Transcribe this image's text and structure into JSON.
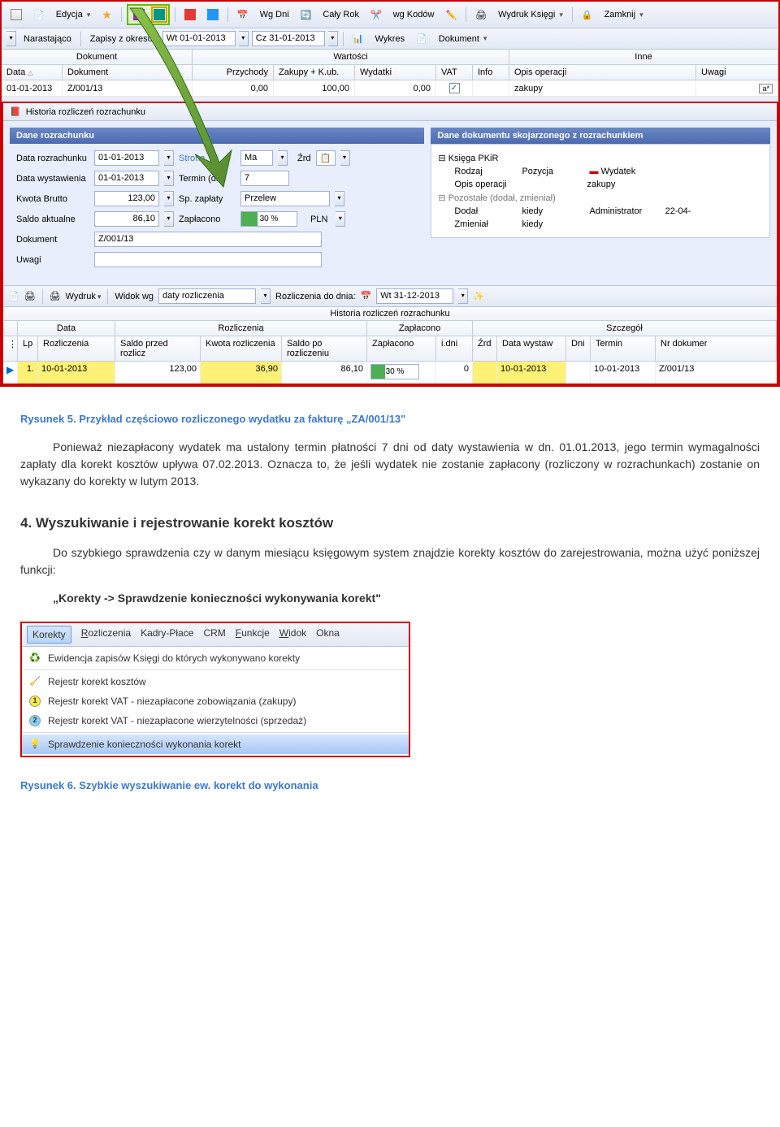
{
  "toolbar": {
    "edycja": "Edycja",
    "wg_dni": "Wg Dni",
    "caly_rok": "Cały Rok",
    "wg_kodow": "wg Kodów",
    "wydruk_ksiegi": "Wydruk Księgi",
    "zamknij": "Zamknij"
  },
  "toolbar2": {
    "narastajaco": "Narastająco",
    "zapisy_z_okresu": "Zapisy z okresu:",
    "date_from": "Wt 01-01-2013",
    "date_to": "Cz 31-01-2013",
    "wykres": "Wykres",
    "dokument": "Dokument"
  },
  "grid": {
    "groups": {
      "dokument": "Dokument",
      "wartosci": "Wartości",
      "inne": "Inne"
    },
    "cols": {
      "data": "Data",
      "dokument": "Dokument",
      "przychody": "Przychody",
      "zakupy": "Zakupy + K.ub.",
      "wydatki": "Wydatki",
      "vat": "VAT",
      "info": "Info",
      "opis": "Opis operacji",
      "uwagi": "Uwagi"
    },
    "row": {
      "data": "01-01-2013",
      "dokument": "Z/001/13",
      "przychody": "0,00",
      "zakupy": "100,00",
      "wydatki": "0,00",
      "vat_checked": "✓",
      "opis": "zakupy"
    }
  },
  "panel": {
    "title": "Historia rozliczeń rozrachunku",
    "left_hdr": "Dane rozrachunku",
    "right_hdr": "Dane dokumentu skojarzonego z rozrachunkiem",
    "left": {
      "data_rozr_lbl": "Data rozrachunku",
      "data_rozr": "01-01-2013",
      "strona_lbl": "Strona",
      "strona": "Ma",
      "zrd_lbl": "Źrd",
      "data_wyst_lbl": "Data wystawienia",
      "data_wyst": "01-01-2013",
      "termin_lbl": "Termin (dni)",
      "termin": "7",
      "kwota_lbl": "Kwota Brutto",
      "kwota": "123,00",
      "sp_zaplaty_lbl": "Sp. zapłaty",
      "sp_zaplaty": "Przelew",
      "saldo_lbl": "Saldo aktualne",
      "saldo": "86,10",
      "zaplacono_lbl": "Zapłacono",
      "zaplacono_pct": "30 %",
      "pln": "PLN",
      "dokument_lbl": "Dokument",
      "dokument": "Z/001/13",
      "uwagi_lbl": "Uwagi"
    },
    "right": {
      "ksiega": "Księga PKiR",
      "rodzaj_lbl": "Rodzaj",
      "pozycja_lbl": "Pozycja",
      "wydatek": "Wydatek",
      "opis_lbl": "Opis operacji",
      "opis": "zakupy",
      "pozostale": "Pozostałe (dodał, zmieniał)",
      "dodal_lbl": "Dodał",
      "kiedy_lbl": "kiedy",
      "admin": "Administrator",
      "data": "22-04-",
      "zmienial_lbl": "Zmieniał",
      "kiedy2_lbl": "kiedy"
    }
  },
  "bottom_tb": {
    "wydruk": "Wydruk",
    "widok_wg": "Widok wg",
    "daty_rozl": "daty rozliczenia",
    "rozl_do_dnia": "Rozliczenia do dnia:",
    "date": "Wt 31-12-2013"
  },
  "hist": {
    "title": "Historia rozliczeń rozrachunku",
    "groups": {
      "data": "Data",
      "rozl": "Rozliczenia",
      "zapl": "Zapłacono",
      "szcz": "Szczegół"
    },
    "cols": {
      "lp": "Lp",
      "rozl": "Rozliczenia",
      "saldo_przed": "Saldo przed rozlicz",
      "kwota": "Kwota rozliczenia",
      "saldo_po": "Saldo po rozliczeniu",
      "zapl": "Zapłacono",
      "idni": "i.dni",
      "zrd": "Źrd",
      "data_wyst": "Data wystaw",
      "dni": "Dni",
      "termin": "Termin",
      "nr_dok": "Nr dokumer"
    },
    "row": {
      "lp": "1.",
      "rozl": "10-01-2013",
      "saldo_przed": "123,00",
      "kwota": "36,90",
      "saldo_po": "86,10",
      "zapl": "30 %",
      "idni": "0",
      "data_wyst": "10-01-2013",
      "termin": "10-01-2013",
      "nr_dok": "Z/001/13"
    }
  },
  "doc": {
    "fig5": "Rysunek 5. Przykład częściowo rozliczonego wydatku za fakturę „ZA/001/13\"",
    "para1": "Ponieważ niezapłacony wydatek ma ustalony termin płatności 7 dni od daty wystawienia w dn. 01.01.2013, jego termin wymagalności zapłaty dla korekt kosztów upływa 07.02.2013. Oznacza to, że jeśli wydatek nie zostanie zapłacony (rozliczony w rozrachunkach) zostanie on wykazany do korekty w lutym 2013.",
    "h2": "4. Wyszukiwanie i rejestrowanie korekt kosztów",
    "para2": "Do szybkiego sprawdzenia czy w danym miesiącu księgowym system znajdzie korekty kosztów do zarejestrowania, można użyć poniższej funkcji:",
    "quote": "„Korekty  -> Sprawdzenie konieczności wykonywania korekt\"",
    "fig6": "Rysunek 6. Szybkie wyszukiwanie ew. korekt do wykonania"
  },
  "menu": {
    "items": [
      "Korekty",
      "Rozliczenia",
      "Kadry-Płace",
      "CRM",
      "Funkcje",
      "Widok",
      "Okna"
    ],
    "m1": "Ewidencja zapisów Księgi do których wykonywano korekty",
    "m2": "Rejestr korekt kosztów",
    "m3": "Rejestr korekt VAT - niezapłacone zobowiązania  (zakupy)",
    "m4": "Rejestr korekt VAT - niezapłacone wierzytelności (sprzedaż)",
    "m5": "Sprawdzenie konieczności wykonania korekt"
  }
}
